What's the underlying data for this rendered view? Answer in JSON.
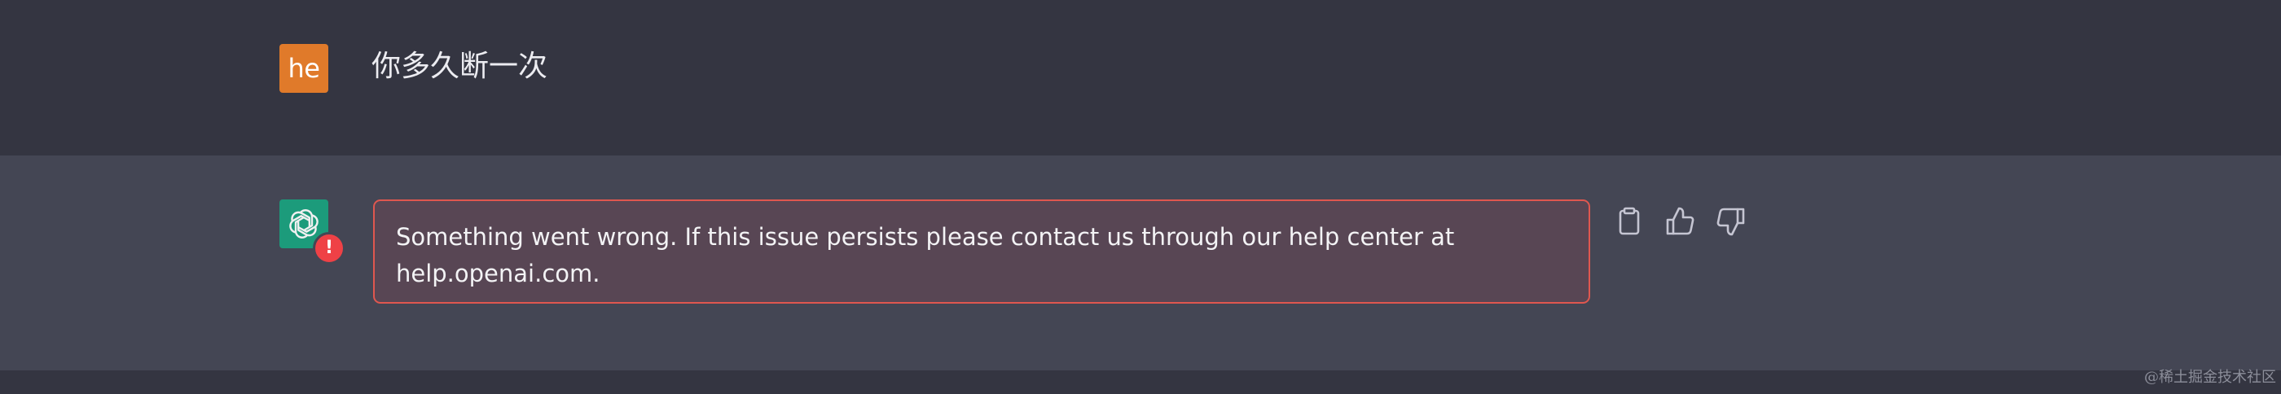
{
  "user_message": {
    "avatar_initials": "he",
    "text": "你多久断一次"
  },
  "assistant_message": {
    "avatar_icon": "openai-logo-icon",
    "status_icon": "error-icon",
    "error_badge": "!",
    "error_text": "Something went wrong. If this issue persists please contact us through our help center at help.openai.com."
  },
  "actions": {
    "copy_icon": "clipboard-icon",
    "like_icon": "thumbs-up-icon",
    "dislike_icon": "thumbs-down-icon"
  },
  "watermark": "@稀土掘金技术社区",
  "colors": {
    "page_background": "#343541",
    "assistant_background": "#444654",
    "user_avatar": "#e07a2a",
    "bot_avatar": "#19a37f",
    "error_border": "#e0574f",
    "error_background": "#584654",
    "error_badge": "#ef4146"
  }
}
